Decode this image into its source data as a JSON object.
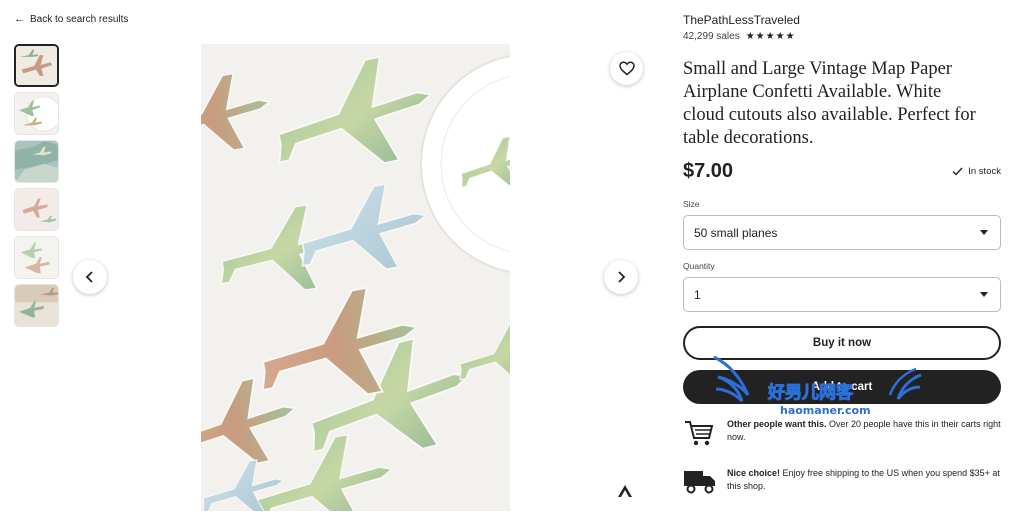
{
  "nav": {
    "back_label": "Back to search results"
  },
  "shop": {
    "name": "ThePathLessTraveled",
    "sales": "42,299 sales",
    "stars": "★★★★★"
  },
  "product": {
    "title": "Small and Large Vintage Map Paper Airplane Confetti Available. White cloud cutouts also available. Perfect for table decorations.",
    "price": "$7.00",
    "stock": "In stock"
  },
  "options": {
    "size_label": "Size",
    "size_value": "50 small planes",
    "quantity_label": "Quantity",
    "quantity_value": "1"
  },
  "actions": {
    "buy_now": "Buy it now",
    "add_to_cart": "Add to cart"
  },
  "notices": [
    {
      "bold": "Other people want this.",
      "text": " Over 20 people have this in their carts right now."
    },
    {
      "bold": "Nice choice!",
      "text": " Enjoy free shipping to the US when you spend $35+ at this shop."
    }
  ],
  "watermark": {
    "cn": "好男儿网客",
    "en": "haomaner.com"
  },
  "icons": [
    "arrow-left-icon",
    "heart-icon",
    "chevron-left-icon",
    "chevron-right-icon",
    "checkmark-icon",
    "cart-icon",
    "truck-icon",
    "caret-down-icon"
  ],
  "colors": {
    "text": "#222222",
    "button_dark": "#222222",
    "watermark_blue": "#2b6fd8"
  }
}
